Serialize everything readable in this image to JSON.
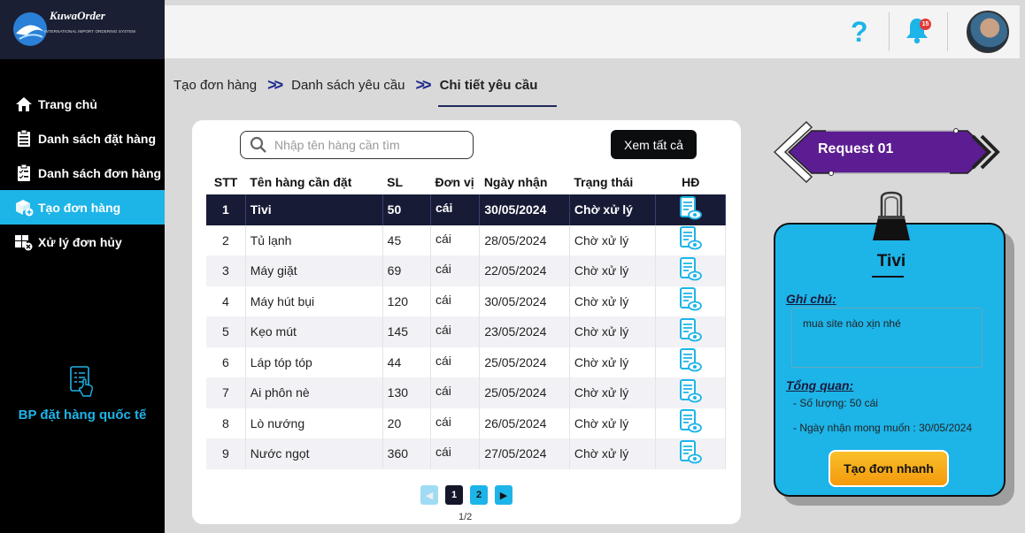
{
  "app": {
    "logo_title": "KuwaOrder",
    "logo_subtitle": "INTERNATIONAL IMPORT ORDERING SYSTEM",
    "department": "BP đặt hàng quốc tế"
  },
  "sidebar": {
    "items": [
      {
        "label": "Trang chủ",
        "icon": "home-icon",
        "active": false
      },
      {
        "label": "Danh sách đặt hàng",
        "icon": "clipboard-list-icon",
        "active": false
      },
      {
        "label": "Danh sách đơn hàng",
        "icon": "checklist-icon",
        "active": false
      },
      {
        "label": "Tạo đơn hàng",
        "icon": "box-add-icon",
        "active": true
      },
      {
        "label": "Xử lý đơn hủy",
        "icon": "cancel-order-icon",
        "active": false
      }
    ]
  },
  "header": {
    "help_icon": "question-icon",
    "notification_count": "15"
  },
  "breadcrumb": {
    "items": [
      "Tạo đơn hàng",
      "Danh sách yêu cầu",
      "Chi tiết yêu cầu"
    ]
  },
  "search": {
    "placeholder": "Nhập tên hàng cần tìm",
    "view_all": "Xem tất cả"
  },
  "table": {
    "headers": [
      "STT",
      "Tên hàng cần đặt",
      "SL",
      "Đơn vị",
      "Ngày nhận",
      "Trạng thái",
      "HĐ"
    ],
    "rows": [
      {
        "stt": "1",
        "name": "Tivi",
        "qty": "50",
        "unit": "cái",
        "date": "30/05/2024",
        "status": "Chờ xử lý",
        "selected": true
      },
      {
        "stt": "2",
        "name": "Tủ lạnh",
        "qty": "45",
        "unit": "cái",
        "date": "28/05/2024",
        "status": "Chờ xử lý"
      },
      {
        "stt": "3",
        "name": "Máy giặt",
        "qty": "69",
        "unit": "cái",
        "date": "22/05/2024",
        "status": "Chờ xử lý"
      },
      {
        "stt": "4",
        "name": "Máy hút bụi",
        "qty": "120",
        "unit": "cái",
        "date": "30/05/2024",
        "status": "Chờ xử lý"
      },
      {
        "stt": "5",
        "name": "Kẹo mút",
        "qty": "145",
        "unit": "cái",
        "date": "23/05/2024",
        "status": "Chờ xử lý"
      },
      {
        "stt": "6",
        "name": "Láp tóp tóp",
        "qty": "44",
        "unit": "cái",
        "date": "25/05/2024",
        "status": "Chờ xử lý"
      },
      {
        "stt": "7",
        "name": "Ai phôn nè",
        "qty": "130",
        "unit": "cái",
        "date": "25/05/2024",
        "status": "Chờ xử lý"
      },
      {
        "stt": "8",
        "name": "Lò nướng",
        "qty": "20",
        "unit": "cái",
        "date": "26/05/2024",
        "status": "Chờ xử lý"
      },
      {
        "stt": "9",
        "name": "Nước ngọt",
        "qty": "360",
        "unit": "cái",
        "date": "27/05/2024",
        "status": "Chờ xử lý"
      }
    ]
  },
  "pagination": {
    "pages": [
      "1",
      "2"
    ],
    "current": "1",
    "info": "1/2"
  },
  "detail": {
    "request_label": "Request 01",
    "item_name": "Tivi",
    "note_label": "Ghi chú:",
    "note_text": "mua site nào xịn nhé",
    "overview_label": "Tổng quan:",
    "quantity_line": "- Số lượng:  50 cái",
    "date_line": "- Ngày nhận mong muốn :  30/05/2024",
    "quick_order_button": "Tạo đơn nhanh"
  },
  "colors": {
    "accent": "#1db4e8",
    "sidebar_bg": "#000000",
    "selected_row": "#171b35",
    "request_banner": "#5b1d91",
    "quick_button": "#f5a814"
  }
}
